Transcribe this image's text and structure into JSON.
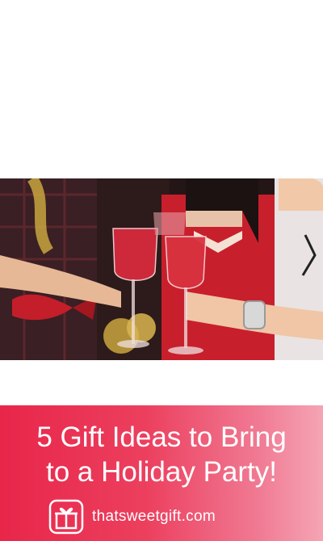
{
  "banner": {
    "title_line1": "5 Gift Ideas to Bring",
    "title_line2": "to a Holiday Party!",
    "site": "thatsweetgift.com",
    "gradient_start": "#e8264a",
    "gradient_end": "#f5a5b5"
  },
  "photo": {
    "icon": "holiday-toast-photo"
  },
  "logo": {
    "icon": "gift-logo-icon"
  }
}
